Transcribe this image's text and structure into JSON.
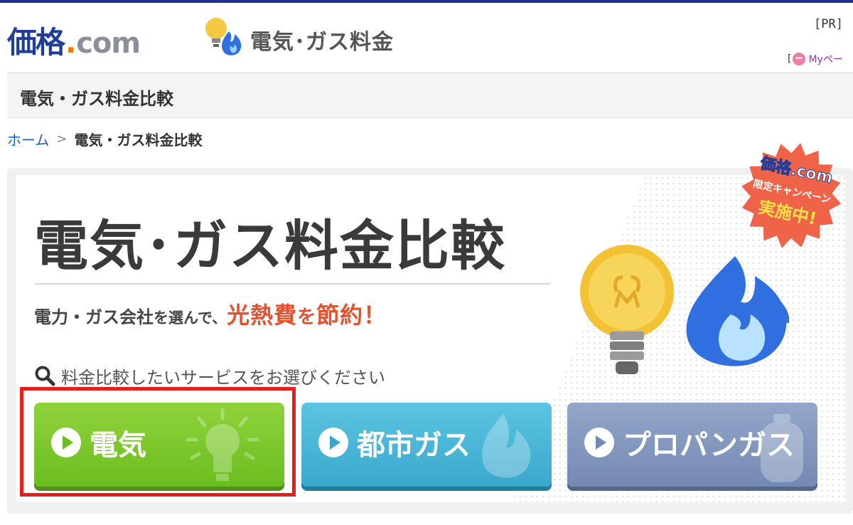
{
  "header": {
    "logo_kanji": "価格",
    "logo_dot": ".",
    "logo_com": "com",
    "service_title": "電気･ガス料金",
    "pr": "[PR]",
    "mypage_bracket": "[",
    "mypage_label": "Myペー"
  },
  "category": {
    "title": "電気・ガス料金比較"
  },
  "breadcrumb": {
    "home": "ホーム",
    "separator": ">",
    "current": "電気・ガス料金比較"
  },
  "hero": {
    "title": "電気･ガス料金比較",
    "subtitle_a": "電力・ガス会社",
    "subtitle_b": "を選んで、",
    "subtitle_c": "光熱費",
    "subtitle_d": "を",
    "subtitle_e": "節約！",
    "search_hint": "料金比較したいサービスをお選びください",
    "badge_line1": "価格.com",
    "badge_line2": "限定キャンペーン",
    "badge_line3": "実施中!"
  },
  "buttons": [
    {
      "label": "電気",
      "color": "#6cbd20"
    },
    {
      "label": "都市ガス",
      "color": "#3aa8cc"
    },
    {
      "label": "プロパンガス",
      "color": "#7489b3"
    }
  ],
  "colors": {
    "brand": "#1f3d99",
    "accent": "#e8502b",
    "highlight": "#e3201b"
  },
  "icons": [
    "bulb-flame-icon",
    "smiley-icon",
    "search-icon",
    "play-icon",
    "bulb-icon",
    "flame-icon",
    "gas-cylinder-icon"
  ]
}
